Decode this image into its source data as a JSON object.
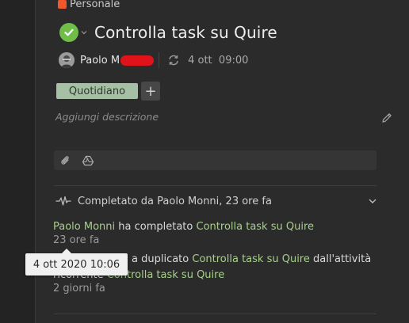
{
  "project": {
    "label": "Personale",
    "color": "#f0572b"
  },
  "task": {
    "title": "Controlla task su Quire",
    "status_color": "#6fbe4a"
  },
  "meta": {
    "assignee": "Paolo M",
    "due_date": "4 ott",
    "due_time": "09:00"
  },
  "tags": [
    "Quotidiano"
  ],
  "add_tag_label": "+",
  "description_placeholder": "Aggiungi descrizione",
  "activity": {
    "summary": "Completato da Paolo Monni, 23 ore fa",
    "entries": [
      {
        "actor": "Paolo Monni",
        "action": "ha completato",
        "target": "Controlla task su Quire",
        "time": "23 ore fa"
      },
      {
        "actor_hidden": "",
        "action": "a duplicato",
        "target": "Controlla task su Quire",
        "suffix": "dall'attività",
        "line2_prefix": "ricorrente",
        "line2_target": "Controlla task su Quire",
        "time": "2 giorni fa"
      }
    ]
  },
  "tooltip": {
    "text": "4 ott 2020 10:06"
  },
  "colors": {
    "accent_link": "#a7d08b",
    "background": "#2b2b2b",
    "tag_bg": "#a6c0a6"
  }
}
